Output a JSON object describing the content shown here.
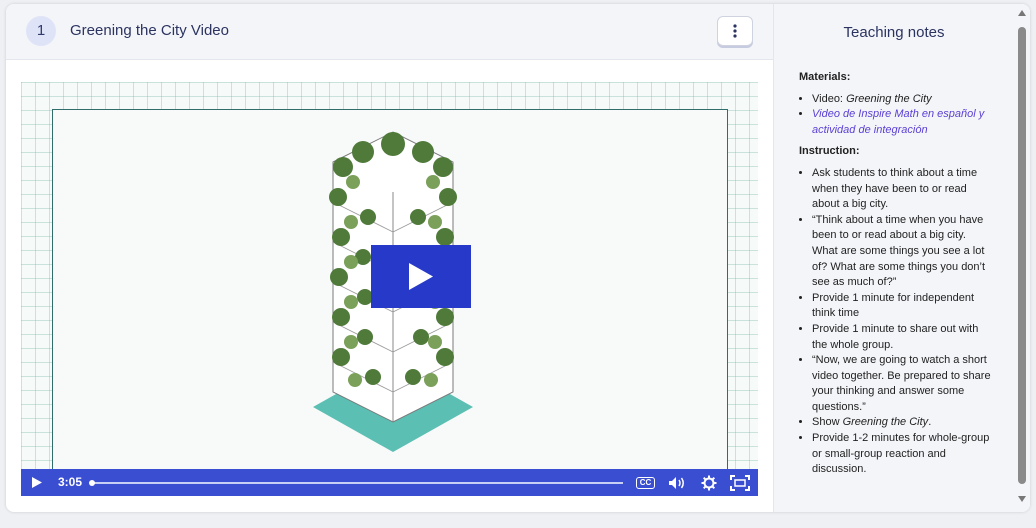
{
  "header": {
    "step_number": "1",
    "title": "Greening the City Video",
    "menu_icon": "kebab-menu-icon"
  },
  "video": {
    "current_time": "3:05",
    "progress_fraction": 0.0,
    "cc_label": "CC",
    "play_icon": "play-icon",
    "volume_icon": "volume-icon",
    "settings_icon": "gear-icon",
    "fullscreen_icon": "fullscreen-icon",
    "accent_color": "#3a4ed2",
    "play_button_color": "#2639c9"
  },
  "notes": {
    "title": "Teaching notes",
    "materials_heading": "Materials",
    "materials": {
      "video_prefix": "Video: ",
      "video_title": "Greening the City",
      "link": "Video de Inspire Math en español y actividad de integración"
    },
    "instruction_heading": "Instruction",
    "instructions": [
      "Ask students to think about a time when they have been to or read about a big city.",
      "“Think about a time when you have been to or read about a big city. What are some things you see a lot of? What are some things you don’t see as much of?”",
      "Provide 1 minute for independent think time",
      "Provide 1 minute to share out with the whole group.",
      "“Now, we are going to watch a short video together. Be prepared to share your thinking and answer some questions.”"
    ],
    "show_prefix": "Show ",
    "show_title": "Greening the City",
    "show_suffix": ".",
    "last_instruction": "Provide 1-2 minutes for whole-group or small-group reaction and discussion."
  }
}
